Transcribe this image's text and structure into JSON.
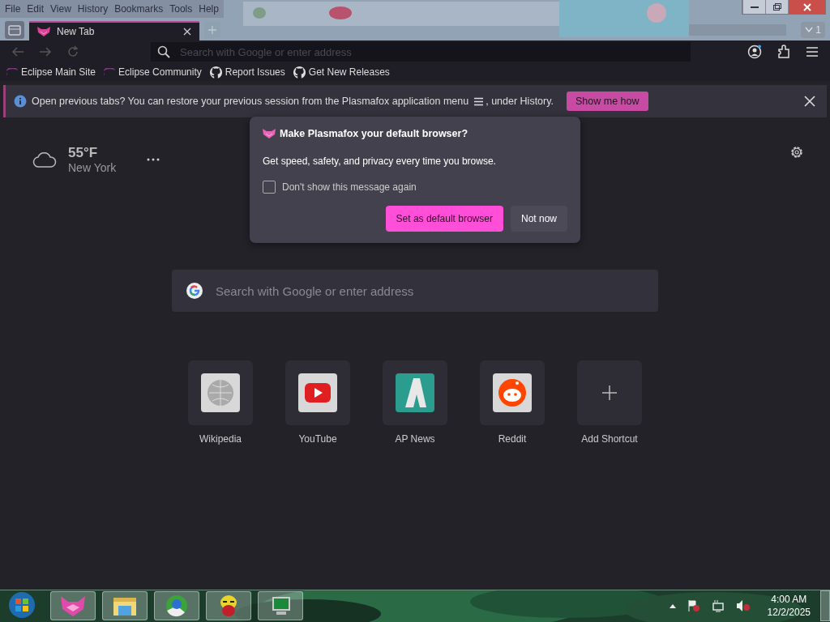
{
  "menu_bar": [
    "File",
    "Edit",
    "View",
    "History",
    "Bookmarks",
    "Tools",
    "Help"
  ],
  "tab": {
    "title": "New Tab",
    "selected": true
  },
  "tab_count": "1",
  "address_bar": {
    "placeholder": "Search with Google or enter address"
  },
  "bookmarks": [
    {
      "label": "Eclipse Main Site",
      "kind": "eclipse"
    },
    {
      "label": "Eclipse Community",
      "kind": "eclipse"
    },
    {
      "label": "Report Issues",
      "kind": "github"
    },
    {
      "label": "Get New Releases",
      "kind": "github"
    }
  ],
  "notification": {
    "text_before": "Open previous tabs? You can restore your previous session from the Plasmafox application menu",
    "text_after": ", under History.",
    "button": "Show me how"
  },
  "weather": {
    "temperature": "55°F",
    "location": "New York"
  },
  "dialog": {
    "title": "Make Plasmafox your default browser?",
    "body": "Get speed, safety, and privacy every time you browse.",
    "checkbox": {
      "label": "Don't show this message again",
      "checked": false
    },
    "buttons": [
      {
        "label": "Set as default browser",
        "kind": "primary"
      },
      {
        "label": "Not now",
        "kind": "secondary"
      }
    ]
  },
  "search": {
    "placeholder": "Search with Google or enter address"
  },
  "shortcuts": [
    {
      "label": "Wikipedia",
      "kind": "wikipedia"
    },
    {
      "label": "YouTube",
      "kind": "youtube"
    },
    {
      "label": "AP News",
      "kind": "apnews"
    },
    {
      "label": "Reddit",
      "kind": "reddit"
    },
    {
      "label": "Add Shortcut",
      "kind": "add"
    }
  ],
  "taskbar": {
    "time": "4:00 AM",
    "date": "12/2/2025"
  }
}
